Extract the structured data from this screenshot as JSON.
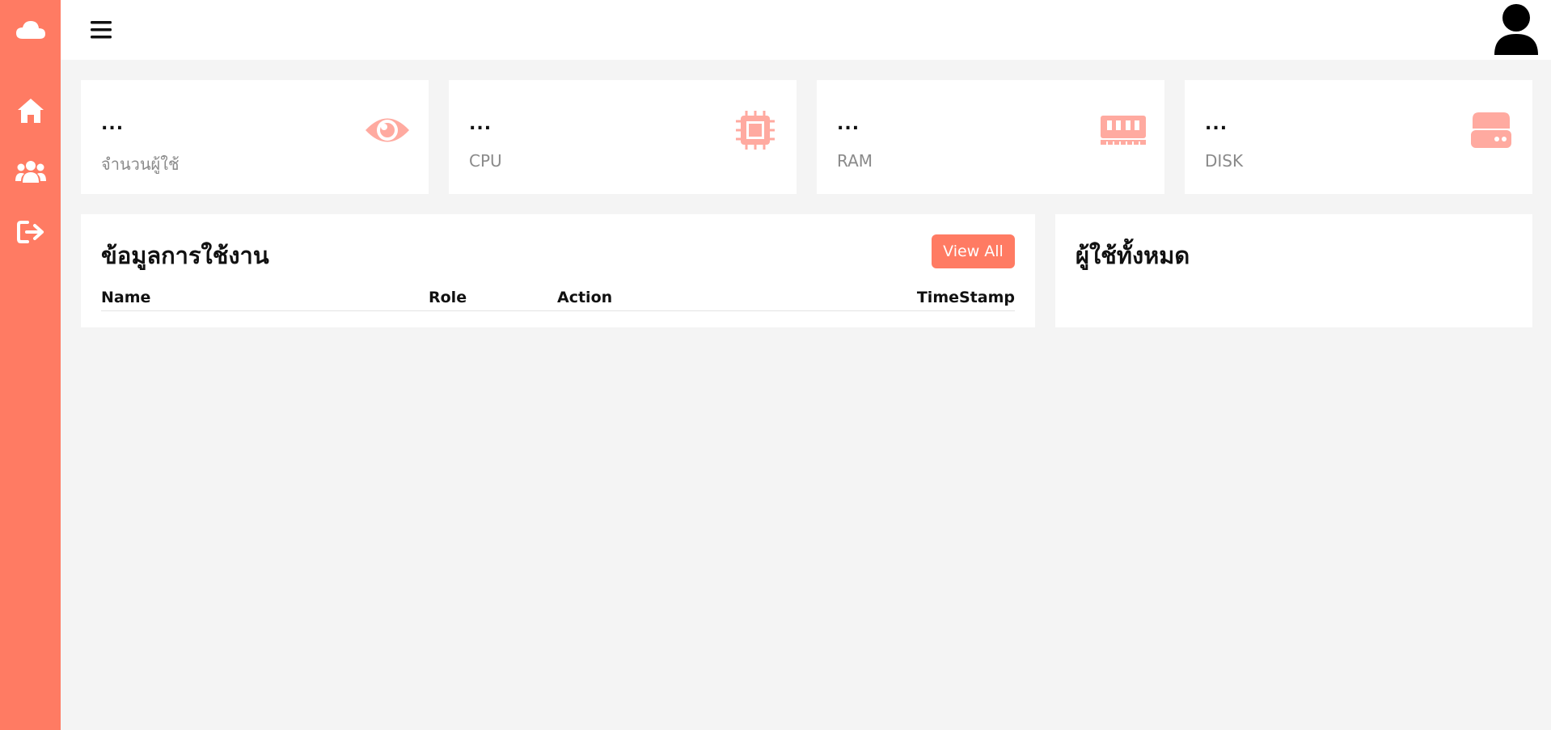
{
  "colors": {
    "accent": "#ff7b63",
    "icon_tint": "#ffaaa0",
    "background": "#f4f4f4",
    "card": "#ffffff",
    "label_gray": "#8a8a8a"
  },
  "sidebar": {
    "items": [
      {
        "icon": "cloud-icon"
      },
      {
        "icon": "home-icon"
      },
      {
        "icon": "users-icon"
      },
      {
        "icon": "logout-icon"
      }
    ]
  },
  "topbar": {
    "menu_icon": "hamburger-icon",
    "avatar_icon": "user-avatar-icon"
  },
  "stats": [
    {
      "value": "...",
      "label": "จำนวนผู้ใช้",
      "icon": "eye-icon"
    },
    {
      "value": "...",
      "label": "CPU",
      "icon": "cpu-chip-icon"
    },
    {
      "value": "...",
      "label": "RAM",
      "icon": "memory-icon"
    },
    {
      "value": "...",
      "label": "DISK",
      "icon": "hard-drive-icon"
    }
  ],
  "activity": {
    "title": "ข้อมูลการใช้งาน",
    "view_all_label": "View All",
    "columns": [
      "Name",
      "Role",
      "Action",
      "TimeStamp"
    ]
  },
  "users_panel": {
    "title": "ผู้ใช้ทั้งหมด"
  }
}
